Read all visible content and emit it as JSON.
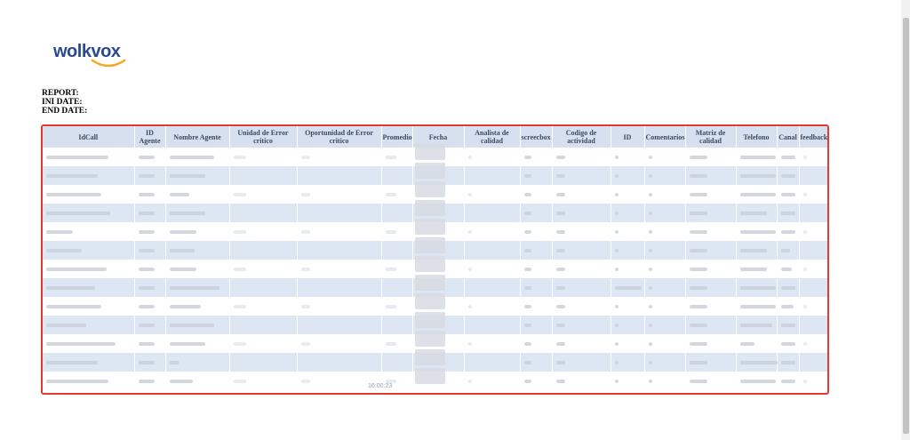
{
  "brand": {
    "name": "wolkvox",
    "arc_color": "#f5a623",
    "text_color": "#2a4a8f"
  },
  "meta": {
    "report_label": "REPORT:",
    "ini_date_label": "INI DATE:",
    "end_date_label": "END DATE:"
  },
  "table": {
    "columns": [
      "IdCall",
      "ID Agente",
      "Nombre Agente",
      "Unidad de Error critico",
      "Oportunidad de Error critico",
      "Promedio",
      "Fecha",
      "Analista de calidad",
      "screecbox",
      "Codigo de actividad",
      "ID",
      "Comentarios",
      "Matriz de calidad",
      "Telefono",
      "Canal",
      "feedback"
    ],
    "row_count": 13,
    "header_bg": "#d6e0ee",
    "stripe_bg": "#dde6f3",
    "frame_color": "#e53935"
  },
  "footer_fragment": "16:00:23"
}
